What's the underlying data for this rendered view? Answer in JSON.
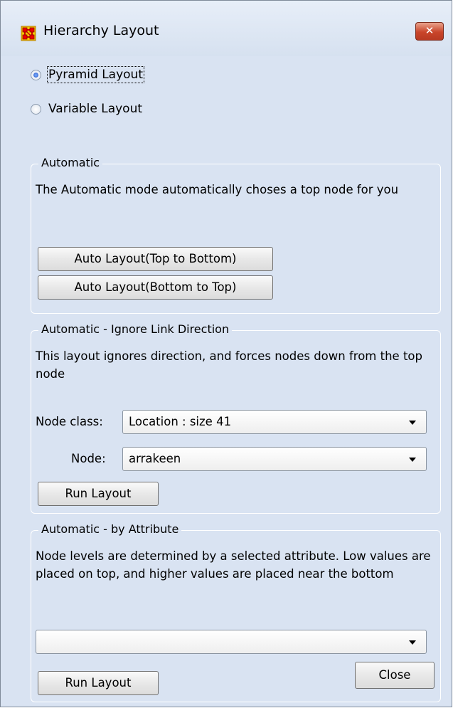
{
  "window": {
    "title": "Hierarchy Layout",
    "close_glyph": "✕",
    "icon": "network-grid-icon",
    "accent_color": "#c9452a"
  },
  "layout_mode": {
    "options": [
      {
        "label": "Pyramid Layout",
        "checked": true
      },
      {
        "label": "Variable Layout",
        "checked": false
      }
    ]
  },
  "automatic": {
    "legend": "Automatic",
    "description": "The Automatic mode automatically choses a top node for you",
    "btn_top_to_bottom": "Auto Layout(Top to Bottom)",
    "btn_bottom_to_top": "Auto Layout(Bottom to Top)"
  },
  "ignore_direction": {
    "legend": "Automatic - Ignore Link Direction",
    "description": "This layout ignores direction, and forces nodes down from the top node",
    "node_class_label": "Node class:",
    "node_class_value": "Location : size 41",
    "node_label": "Node:",
    "node_value": "arrakeen",
    "run_label": "Run Layout"
  },
  "by_attribute": {
    "legend": "Automatic - by Attribute",
    "description": "Node levels are determined by a selected attribute. Low values are placed on top, and higher values are placed near the bottom",
    "attribute_value": "",
    "run_label": "Run Layout"
  },
  "footer": {
    "close_label": "Close"
  }
}
